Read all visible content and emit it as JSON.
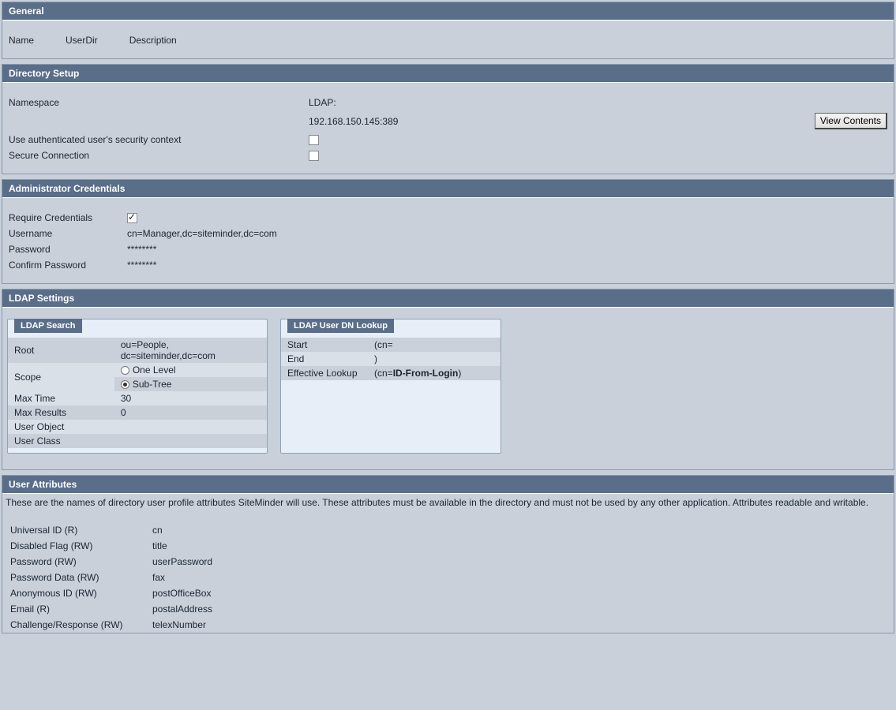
{
  "general": {
    "title": "General",
    "name_label": "Name",
    "userdir_label": "UserDir",
    "description_label": "Description"
  },
  "directory_setup": {
    "title": "Directory Setup",
    "namespace_label": "Namespace",
    "namespace_value": "LDAP:",
    "server_value": "192.168.150.145:389",
    "view_contents_label": "View Contents",
    "auth_context_label": "Use authenticated user's security context",
    "secure_conn_label": "Secure Connection"
  },
  "admin_creds": {
    "title": "Administrator Credentials",
    "require_label": "Require Credentials",
    "username_label": "Username",
    "username_value": "cn=Manager,dc=siteminder,dc=com",
    "password_label": "Password",
    "password_value": "********",
    "confirm_label": "Confirm Password",
    "confirm_value": "********"
  },
  "ldap_settings": {
    "title": "LDAP Settings",
    "search": {
      "title": "LDAP Search",
      "root_label": "Root",
      "root_value": "ou=People, dc=siteminder,dc=com",
      "scope_label": "Scope",
      "scope_one_level": "One Level",
      "scope_sub_tree": "Sub-Tree",
      "max_time_label": "Max Time",
      "max_time_value": "30",
      "max_results_label": "Max Results",
      "max_results_value": "0",
      "user_object_label": "User Object",
      "user_object_value": "",
      "user_class_label": "User Class",
      "user_class_value": ""
    },
    "lookup": {
      "title": "LDAP User DN Lookup",
      "start_label": "Start",
      "start_value": "(cn=",
      "end_label": "End",
      "end_value": ")",
      "effective_label": "Effective Lookup",
      "effective_prefix": "(cn=",
      "effective_id": "ID-From-Login",
      "effective_suffix": ")"
    }
  },
  "user_attributes": {
    "title": "User Attributes",
    "description": "These are the names of directory user profile attributes SiteMinder will use. These attributes must be available in the directory and must not be used by any other application. Attributes readable and writable.",
    "rows": [
      {
        "label": "Universal ID (R)",
        "value": "cn"
      },
      {
        "label": "Disabled Flag (RW)",
        "value": "title"
      },
      {
        "label": "Password (RW)",
        "value": "userPassword"
      },
      {
        "label": "Password Data (RW)",
        "value": "fax"
      },
      {
        "label": "Anonymous ID (RW)",
        "value": "postOfficeBox"
      },
      {
        "label": "Email (R)",
        "value": "postalAddress"
      },
      {
        "label": "Challenge/Response (RW)",
        "value": "telexNumber"
      }
    ]
  }
}
